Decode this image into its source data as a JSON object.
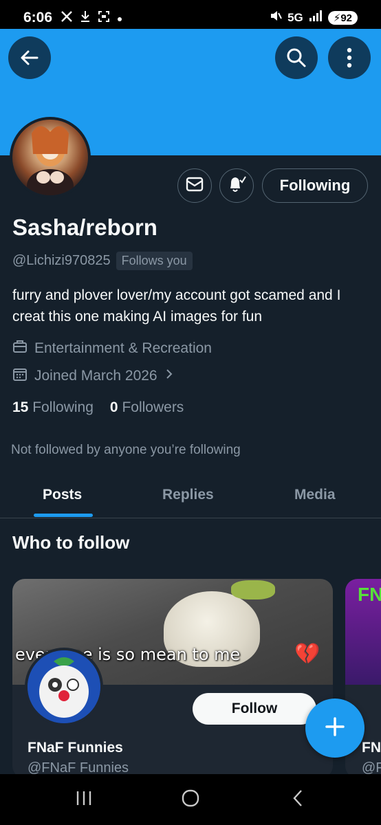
{
  "status_bar": {
    "time": "6:06",
    "network": "5G",
    "battery": "92",
    "icons": [
      "x-logo-icon",
      "download-icon",
      "screenshot-icon",
      "dot-icon",
      "mute-icon",
      "signal-icon",
      "battery-charging-icon"
    ]
  },
  "colors": {
    "accent": "#1d9bf0",
    "background": "#15202b",
    "muted_text": "#8b98a5"
  },
  "header": {
    "back_icon": "arrow-left-icon",
    "search_icon": "search-icon",
    "more_icon": "more-vertical-icon"
  },
  "profile": {
    "name": "Sasha/reborn",
    "handle": "@Lichizi970825",
    "follows_you": "Follows you",
    "bio": "furry and plover lover/my account got scamed and I creat this one making AI images for fun",
    "category": "Entertainment & Recreation",
    "joined": "Joined March 2026",
    "following_count": "15",
    "following_label": "Following",
    "followers_count": "0",
    "followers_label": "Followers",
    "not_followed": "Not followed by anyone you’re following",
    "following_button": "Following"
  },
  "tabs": [
    {
      "label": "Posts",
      "active": true
    },
    {
      "label": "Replies",
      "active": false
    },
    {
      "label": "Media",
      "active": false
    }
  ],
  "who_to_follow": {
    "title": "Who to follow",
    "cards": [
      {
        "name": "FNaF Funnies",
        "handle": "@FNaF Funnies",
        "banner_text": "everyone is so mean to me",
        "follow_label": "Follow"
      },
      {
        "name": "FN",
        "handle": "@F",
        "banner_text": "FN"
      }
    ]
  },
  "nav": {
    "recents": "recents-icon",
    "home": "home-icon",
    "back": "back-icon"
  }
}
